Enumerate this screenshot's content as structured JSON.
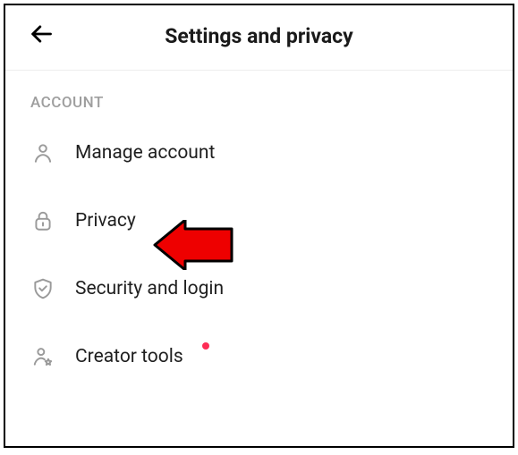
{
  "header": {
    "title": "Settings and privacy"
  },
  "sections": {
    "account": {
      "label": "ACCOUNT",
      "items": [
        {
          "label": "Manage account"
        },
        {
          "label": "Privacy"
        },
        {
          "label": "Security and login"
        },
        {
          "label": "Creator tools",
          "has_badge": true
        }
      ]
    }
  }
}
